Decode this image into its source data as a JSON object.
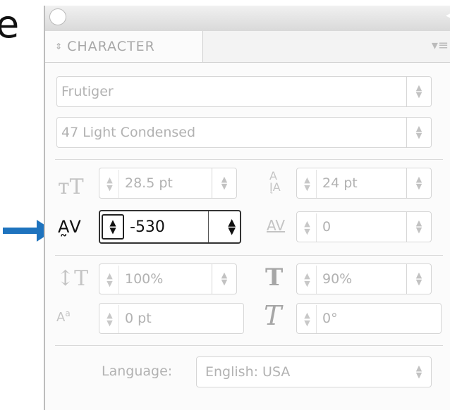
{
  "panel": {
    "tab_label": "CHARACTER",
    "tab_updown_glyph": "⇕",
    "menu_glyph": "▾≡"
  },
  "font": {
    "family": "Frutiger",
    "style": "47 Light Condensed"
  },
  "fields": {
    "font_size": "28.5 pt",
    "leading": "24 pt",
    "kerning": "-530",
    "tracking": "0",
    "vertical_scale": "100%",
    "horizontal_scale": "90%",
    "baseline_shift": "0 pt",
    "skew": "0°"
  },
  "language": {
    "label": "Language:",
    "value": "English: USA"
  },
  "colors": {
    "arrow": "#1e73be",
    "inactive_text": "#b2b2b2",
    "active_border": "#333333"
  }
}
